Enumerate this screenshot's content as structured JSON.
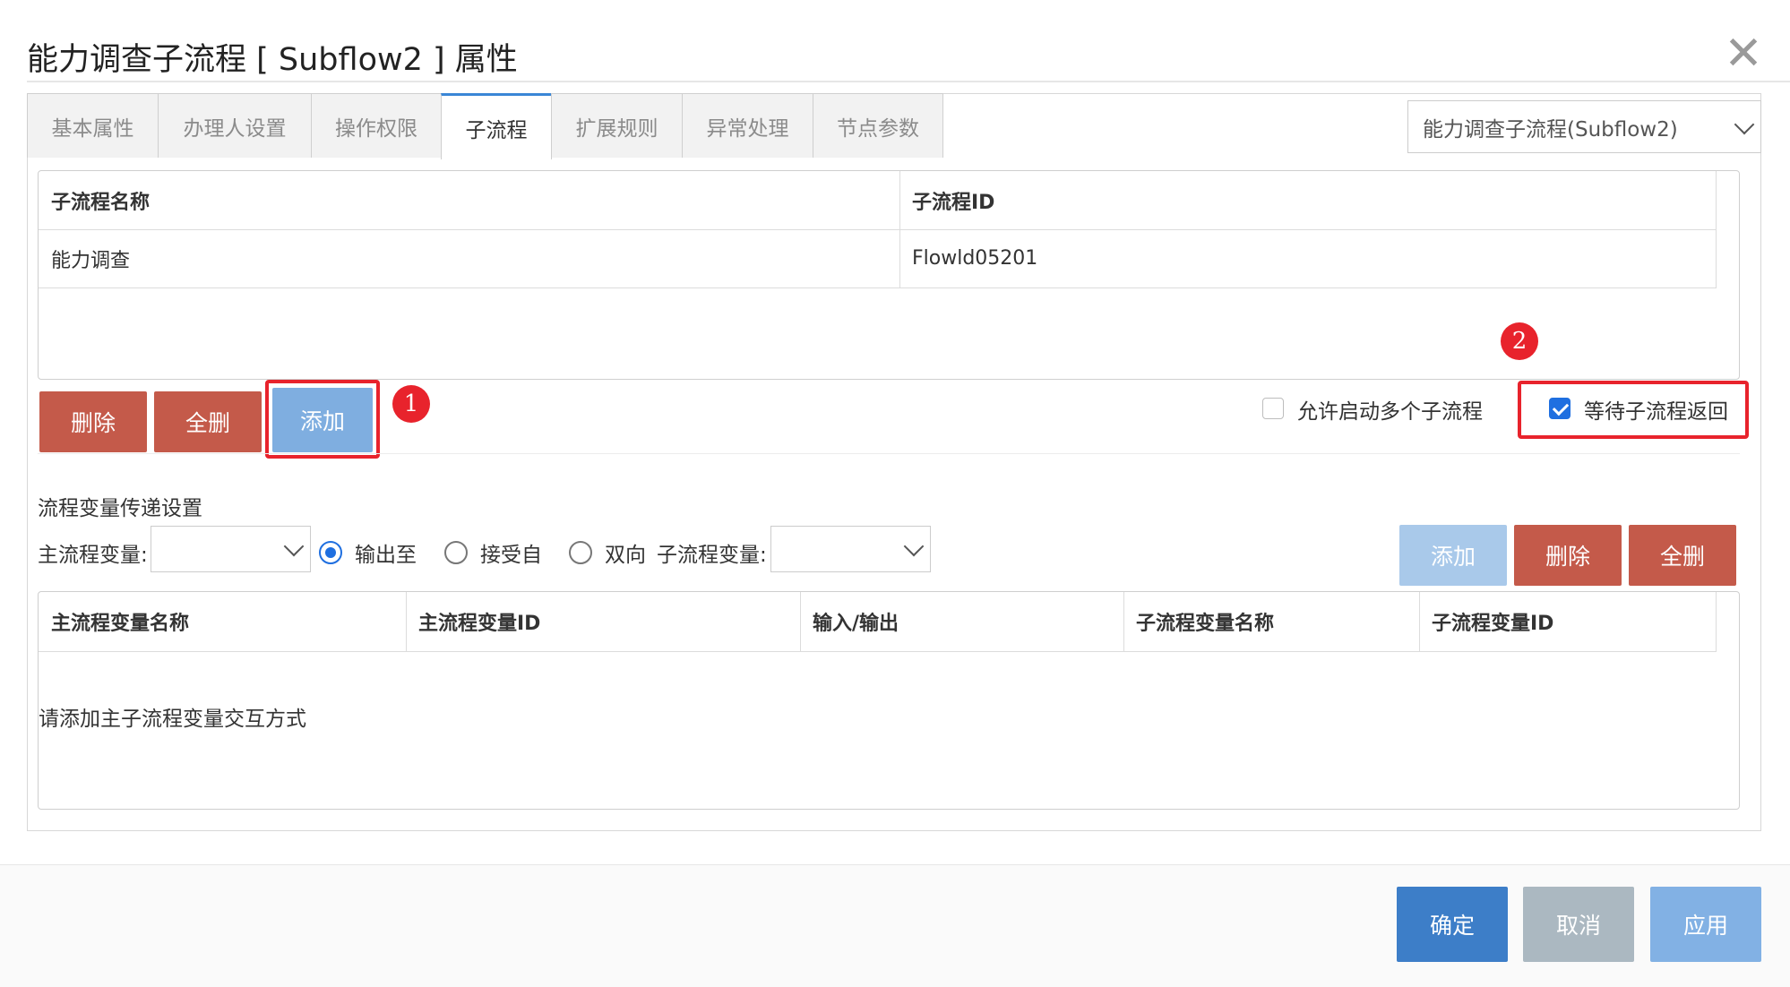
{
  "dialog": {
    "title": "能力调查子流程 [ Subflow2 ] 属性",
    "close_glyph": "✕"
  },
  "tabs": [
    {
      "label": "基本属性"
    },
    {
      "label": "办理人设置"
    },
    {
      "label": "操作权限"
    },
    {
      "label": "子流程",
      "active": true
    },
    {
      "label": "扩展规则"
    },
    {
      "label": "异常处理"
    },
    {
      "label": "节点参数"
    }
  ],
  "node_select": {
    "value": "能力调查子流程(Subflow2)"
  },
  "subflow_table": {
    "headers": [
      "子流程名称",
      "子流程ID"
    ],
    "rows": [
      [
        "能力调查",
        "Flowld05201"
      ]
    ]
  },
  "subflow_buttons": {
    "delete": "删除",
    "delete_all": "全删",
    "add": "添加"
  },
  "options": {
    "allow_multiple": {
      "label": "允许启动多个子流程",
      "checked": false
    },
    "wait_return": {
      "label": "等待子流程返回",
      "checked": true
    }
  },
  "annotations": {
    "badge1": "1",
    "badge2": "2"
  },
  "var_section": {
    "title": "流程变量传递设置",
    "main_var_label": "主流程变量:",
    "main_var_value": "",
    "radios": [
      {
        "label": "输出至",
        "checked": true
      },
      {
        "label": "接受自",
        "checked": false
      },
      {
        "label": "双向",
        "checked": false
      }
    ],
    "sub_var_label": "子流程变量:",
    "sub_var_value": "",
    "buttons": {
      "add": "添加",
      "delete": "删除",
      "delete_all": "全删"
    }
  },
  "var_table": {
    "headers": [
      "主流程变量名称",
      "主流程变量ID",
      "输入/输出",
      "子流程变量名称",
      "子流程变量ID"
    ],
    "empty_text": "请添加主子流程变量交互方式"
  },
  "footer": {
    "ok": "确定",
    "cancel": "取消",
    "apply": "应用"
  },
  "colors": {
    "danger": "#c45a4a",
    "primary": "#3d7ec8",
    "annotation": "#e8232c",
    "checkbox": "#1f6fe0"
  }
}
